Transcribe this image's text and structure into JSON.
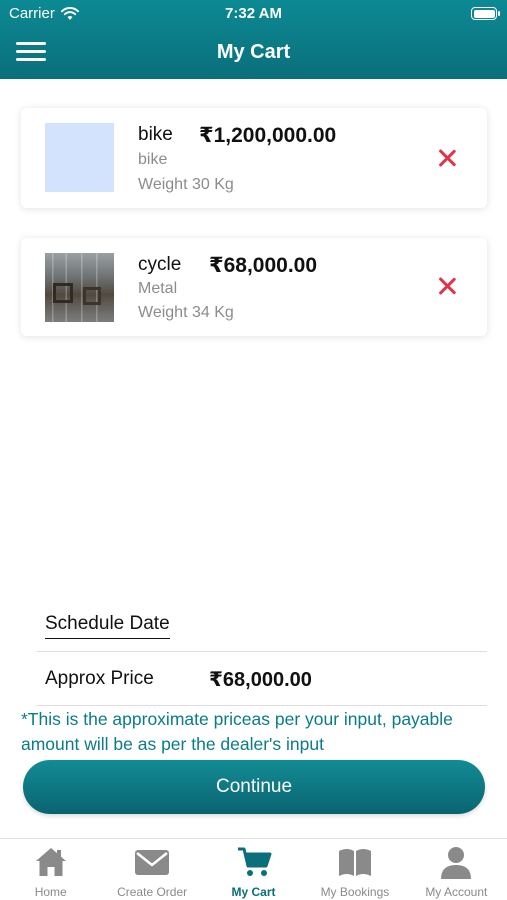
{
  "status_bar": {
    "carrier": "Carrier",
    "time": "7:32 AM"
  },
  "header": {
    "title": "My Cart",
    "menu_icon": "hamburger-menu-icon"
  },
  "cart": {
    "items": [
      {
        "name": "bike",
        "price": "₹1,200,000.00",
        "subtitle": "bike",
        "weight": "Weight 30 Kg",
        "image": "placeholder"
      },
      {
        "name": "cycle",
        "price": "₹68,000.00",
        "subtitle": "Metal",
        "weight": "Weight 34 Kg",
        "image": "metal-pipes-photo"
      }
    ]
  },
  "summary": {
    "schedule_label": "Schedule Date",
    "approx_label": "Approx Price",
    "approx_value": "₹68,000.00",
    "note": "*This is the approximate priceas per your input, payable amount will be as per the dealer's input"
  },
  "continue_label": "Continue",
  "tabs": [
    {
      "label": "Home",
      "icon": "home-icon",
      "active": false
    },
    {
      "label": "Create Order",
      "icon": "mail-icon",
      "active": false
    },
    {
      "label": "My Cart",
      "icon": "cart-icon",
      "active": true
    },
    {
      "label": "My Bookings",
      "icon": "book-icon",
      "active": false
    },
    {
      "label": "My Account",
      "icon": "user-icon",
      "active": false
    }
  ],
  "colors": {
    "brand": "#0a7c86",
    "remove": "#e0344c",
    "tab_inactive": "#8a8a8a"
  }
}
